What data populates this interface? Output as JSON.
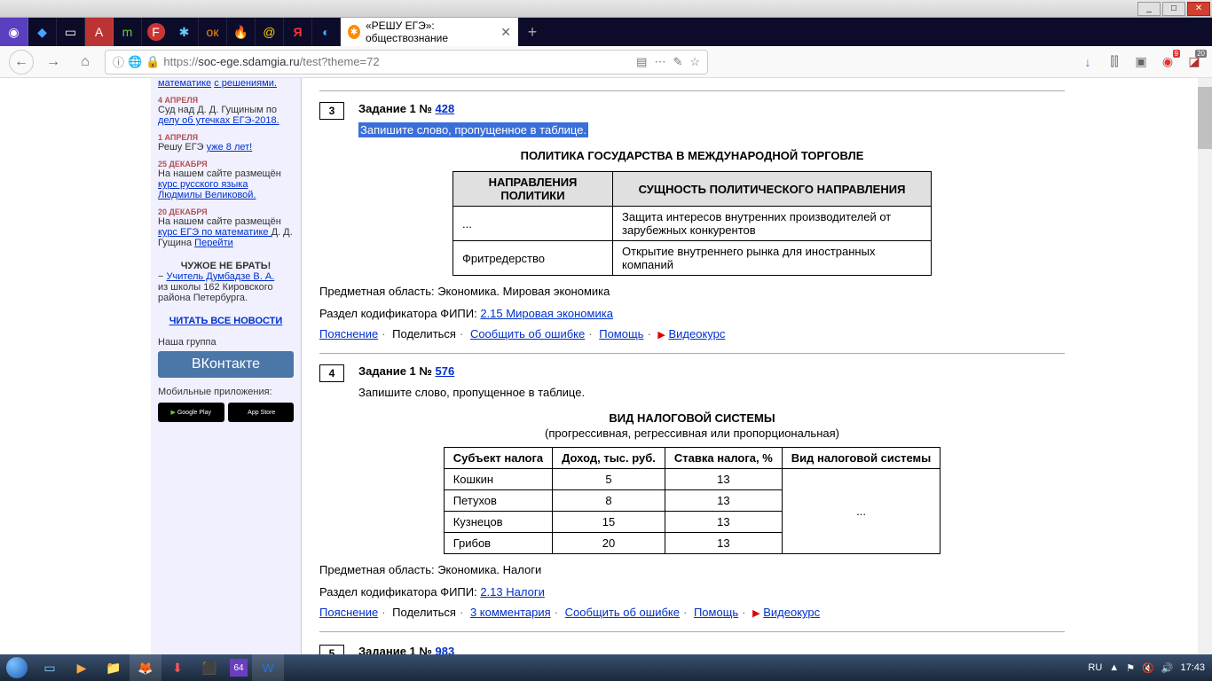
{
  "window": {
    "min": "_",
    "max": "□",
    "close": "✕"
  },
  "tabs": {
    "active_title": "«РЕШУ ЕГЭ»: обществознание",
    "close": "✕",
    "new": "+"
  },
  "addressbar": {
    "back": "←",
    "forward": "→",
    "home": "⌂",
    "info": "ⓘ",
    "lock": "🔒",
    "url_prefix": "https://",
    "url_host": "soc-ege.sdamgia.ru",
    "url_path": "/test?theme=72",
    "reader": "▤",
    "dots": "⋯",
    "edit": "✎",
    "star": "☆",
    "dl": "↓",
    "lib": "⫿⫿",
    "pocket": "▣",
    "abp_badge": "9",
    "ub_badge": "20"
  },
  "sidebar": {
    "math_link": "математике",
    "solutions": "с решениями.",
    "d1": "4 АПРЕЛЯ",
    "n1a": "Суд над Д. Д. Гущиным по ",
    "n1b": "делу об утечках ЕГЭ-2018.",
    "d2": "1 АПРЕЛЯ",
    "n2a": "Решу ЕГЭ ",
    "n2b": "уже 8 лет!",
    "d3": "25 ДЕКАБРЯ",
    "n3a": "На нашем сайте размещён ",
    "n3b": "курс русского языка Людмилы Великовой.",
    "d4": "20 ДЕКАБРЯ",
    "n4a": "На нашем сайте размещён ",
    "n4b": "курс ЕГЭ по математике ",
    "n4c": "Д. Д. Гущина ",
    "n4d": "Перейти",
    "warn": "ЧУЖОЕ НЕ БРАТЬ!",
    "teacher_pre": "− ",
    "teacher": "Учитель Думбадзе В. А.",
    "school": "из школы 162 Кировского района Петербурга.",
    "allnews": "ЧИТАТЬ ВСЕ НОВОСТИ",
    "group": "Наша группа",
    "vk": "ВКонтакте",
    "mobile": "Мобильные приложения:",
    "gplay": "Google Play",
    "astore": "App Store"
  },
  "task3": {
    "num": "3",
    "title_pre": "Задание 1 № ",
    "title_link": "428",
    "instr": "Запишите слово, пропущенное в таблице.",
    "tbl_title": "ПОЛИТИКА ГОСУДАРСТВА В МЕЖДУНАРОДНОЙ ТОРГОВЛЕ",
    "h1": "НАПРАВЛЕНИЯ ПОЛИТИКИ",
    "h2": "СУЩНОСТЬ ПОЛИТИЧЕСКОГО НАПРАВЛЕНИЯ",
    "r1c1": "...",
    "r1c2": "Защита интересов внутренних производителей от зарубежных конкурентов",
    "r2c1": "Фритредерство",
    "r2c2": "Открытие внутреннего рынка для иностранных компаний",
    "m1": "Предметная область: Экономика. Мировая экономика",
    "m2_pre": "Раздел кодификатора ФИПИ: ",
    "m2_link": "2.15 Мировая экономика",
    "a_expl": "Пояснение",
    "a_share": "Поделиться",
    "a_err": "Сообщить об ошибке",
    "a_help": "Помощь",
    "a_video": "Видеокурс"
  },
  "task4": {
    "num": "4",
    "title_pre": "Задание 1 № ",
    "title_link": "576",
    "instr": "Запишите слово, пропущенное в таблице.",
    "tbl_title": "ВИД НАЛОГОВОЙ СИСТЕМЫ",
    "subtitle": "(прогрессивная, регрессивная или пропорциональная)",
    "h1": "Субъект налога",
    "h2": "Доход, тыс. руб.",
    "h3": "Ставка налога, %",
    "h4": "Вид налоговой системы",
    "r1c1": "Кошкин",
    "r1c2": "5",
    "r1c3": "13",
    "r2c1": "Петухов",
    "r2c2": "8",
    "r2c3": "13",
    "r3c1": "Кузнецов",
    "r3c2": "15",
    "r3c3": "13",
    "r4c1": "Грибов",
    "r4c2": "20",
    "r4c3": "13",
    "merged": "...",
    "m1": "Предметная область: Экономика. Налоги",
    "m2_pre": "Раздел кодификатора ФИПИ: ",
    "m2_link": "2.13 Налоги",
    "a_expl": "Пояснение",
    "a_share": "Поделиться",
    "a_comm": "3 комментария",
    "a_err": "Сообщить об ошибке",
    "a_help": "Помощь",
    "a_video": "Видеокурс"
  },
  "task5": {
    "num": "5",
    "title_pre": "Задание 1 № ",
    "title_link": "983"
  },
  "taskbar": {
    "lang": "RU",
    "time": "17:43"
  }
}
